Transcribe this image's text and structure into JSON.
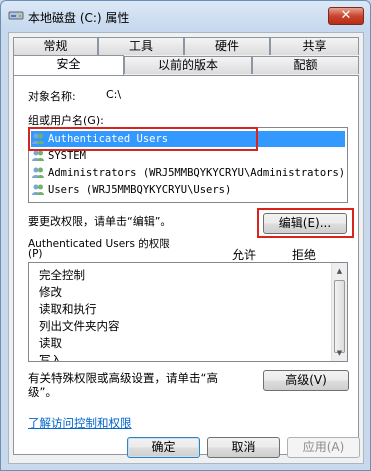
{
  "window": {
    "title": "本地磁盘 (C:) 属性",
    "close": "✕"
  },
  "tabs_row1": [
    "常规",
    "工具",
    "硬件",
    "共享"
  ],
  "tabs_row2": [
    "安全",
    "以前的版本",
    "配额"
  ],
  "object": {
    "label": "对象名称:",
    "value": "C:\\"
  },
  "groups": {
    "label": "组或用户名(G):",
    "items": [
      {
        "name": "Authenticated Users",
        "selected": true
      },
      {
        "name": "SYSTEM",
        "selected": false
      },
      {
        "name": "Administrators (WRJ5MMBQYKYCRYU\\Administrators)",
        "selected": false
      },
      {
        "name": "Users (WRJ5MMBQYKYCRYU\\Users)",
        "selected": false
      }
    ]
  },
  "change_hint": "要更改权限，请单击“编辑”。",
  "edit_button": "编辑(E)...",
  "permissions": {
    "label_line1": "Authenticated Users 的权限",
    "label_line2": "(P)",
    "allow": "允许",
    "deny": "拒绝",
    "items": [
      "完全控制",
      "修改",
      "读取和执行",
      "列出文件夹内容",
      "读取",
      "写入"
    ]
  },
  "advanced": {
    "text_line1": "有关特殊权限或高级设置，请单击“高",
    "text_line2": "级”。",
    "button": "高级(V)"
  },
  "link": "了解访问控制和权限",
  "footer": {
    "ok": "确定",
    "cancel": "取消",
    "apply": "应用(A)"
  },
  "colors": {
    "selection": "#3399ff",
    "highlight_box": "#d9231d",
    "link": "#0066cc"
  }
}
